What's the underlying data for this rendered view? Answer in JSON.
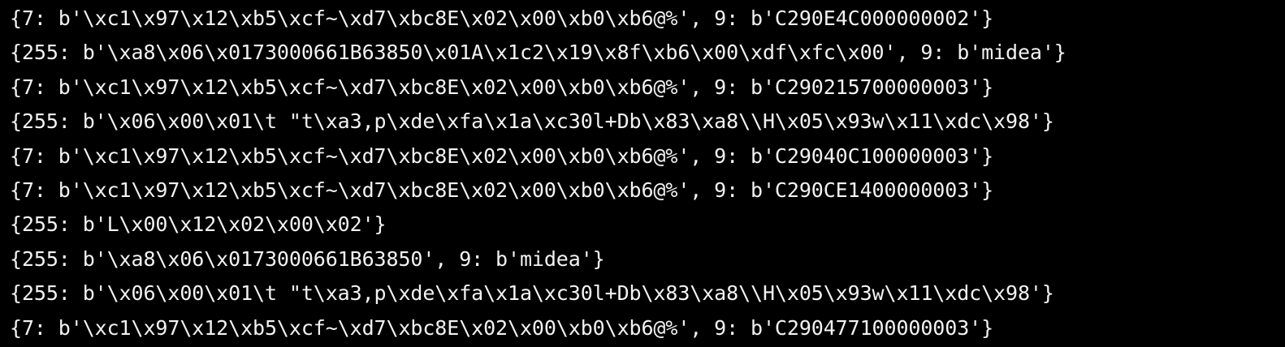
{
  "terminal": {
    "text_color": "#f2f2f2",
    "background_color": "#000000",
    "lines": [
      "{7: b'\\xc1\\x97\\x12\\xb5\\xcf~\\xd7\\xbc8E\\x02\\x00\\xb0\\xb6@%', 9: b'C290E4C000000002'}",
      "{255: b'\\xa8\\x06\\x0173000661B63850\\x01A\\x1c2\\x19\\x8f\\xb6\\x00\\xdf\\xfc\\x00', 9: b'midea'}",
      "{7: b'\\xc1\\x97\\x12\\xb5\\xcf~\\xd7\\xbc8E\\x02\\x00\\xb0\\xb6@%', 9: b'C290215700000003'}",
      "{255: b'\\x06\\x00\\x01\\t \"t\\xa3,p\\xde\\xfa\\x1a\\xc30l+Db\\x83\\xa8\\\\H\\x05\\x93w\\x11\\xdc\\x98'}",
      "{7: b'\\xc1\\x97\\x12\\xb5\\xcf~\\xd7\\xbc8E\\x02\\x00\\xb0\\xb6@%', 9: b'C29040C100000003'}",
      "{7: b'\\xc1\\x97\\x12\\xb5\\xcf~\\xd7\\xbc8E\\x02\\x00\\xb0\\xb6@%', 9: b'C290CE1400000003'}",
      "{255: b'L\\x00\\x12\\x02\\x00\\x02'}",
      "{255: b'\\xa8\\x06\\x0173000661B63850', 9: b'midea'}",
      "{255: b'\\x06\\x00\\x01\\t \"t\\xa3,p\\xde\\xfa\\x1a\\xc30l+Db\\x83\\xa8\\\\H\\x05\\x93w\\x11\\xdc\\x98'}",
      "{7: b'\\xc1\\x97\\x12\\xb5\\xcf~\\xd7\\xbc8E\\x02\\x00\\xb0\\xb6@%', 9: b'C290477100000003'}"
    ]
  }
}
